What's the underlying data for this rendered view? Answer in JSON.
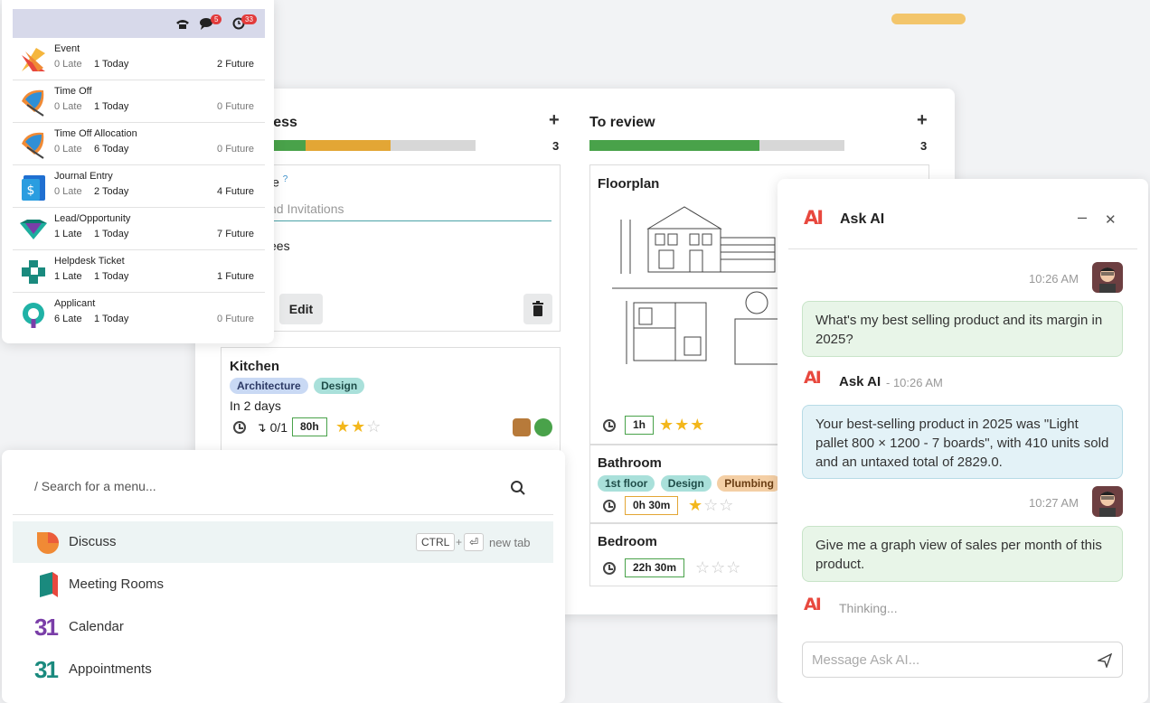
{
  "kanban": {
    "col1": {
      "title": "ress",
      "count": "3"
    },
    "col2": {
      "title": "To review",
      "count": "3"
    },
    "card1": {
      "title_partial": "le",
      "help": "?",
      "field_partial": "nd Invitations",
      "label_partial": "ees",
      "edit": "Edit"
    },
    "kitchen": {
      "title": "Kitchen",
      "tags": [
        "Architecture",
        "Design"
      ],
      "due": "In 2 days",
      "subtasks": "0/1",
      "hours": "80h"
    },
    "floorplan": {
      "title": "Floorplan",
      "hours": "1h"
    },
    "bathroom": {
      "title": "Bathroom",
      "tags": [
        "1st floor",
        "Design",
        "Plumbing"
      ],
      "hours": "0h 30m"
    },
    "bedroom": {
      "title": "Bedroom",
      "hours": "22h 30m"
    }
  },
  "activity": {
    "badge_msgs": "5",
    "badge_activities": "33",
    "rows": [
      {
        "name": "Event",
        "late": "0 Late",
        "today": "1 Today",
        "future": "2 Future"
      },
      {
        "name": "Time Off",
        "late": "0 Late",
        "today": "1 Today",
        "future": "0 Future"
      },
      {
        "name": "Time Off Allocation",
        "late": "0 Late",
        "today": "6 Today",
        "future": "0 Future"
      },
      {
        "name": "Journal Entry",
        "late": "0 Late",
        "today": "2 Today",
        "future": "4 Future"
      },
      {
        "name": "Lead/Opportunity",
        "late": "1 Late",
        "today": "1 Today",
        "future": "7 Future"
      },
      {
        "name": "Helpdesk Ticket",
        "late": "1 Late",
        "today": "1 Today",
        "future": "1 Future"
      },
      {
        "name": "Applicant",
        "late": "6 Late",
        "today": "1 Today",
        "future": "0 Future"
      }
    ]
  },
  "menu": {
    "search_placeholder": "/ Search for a menu...",
    "kbd_ctrl": "CTRL",
    "kbd_plus": "+",
    "kbd_enter": "⏎",
    "new_tab": "new tab",
    "items": [
      "Discuss",
      "Meeting Rooms",
      "Calendar",
      "Appointments"
    ],
    "calendar_num": "31"
  },
  "chat": {
    "title": "Ask AI",
    "logo": "AI",
    "minimize": "–",
    "close": "✕",
    "t1": "10:26 AM",
    "msg1": "What's my best selling product and its margin in 2025?",
    "ai_name": "Ask AI",
    "ai_time": "- 10:26 AM",
    "reply1": "Your best-selling product in 2025 was \"Light pallet 800 × 1200 - 7 boards\", with 410 units sold and an untaxed total of 2829.0.",
    "t2": "10:27 AM",
    "msg2": "Give me a graph view of sales per month of this product.",
    "thinking": "Thinking...",
    "input_placeholder": "Message Ask AI..."
  }
}
